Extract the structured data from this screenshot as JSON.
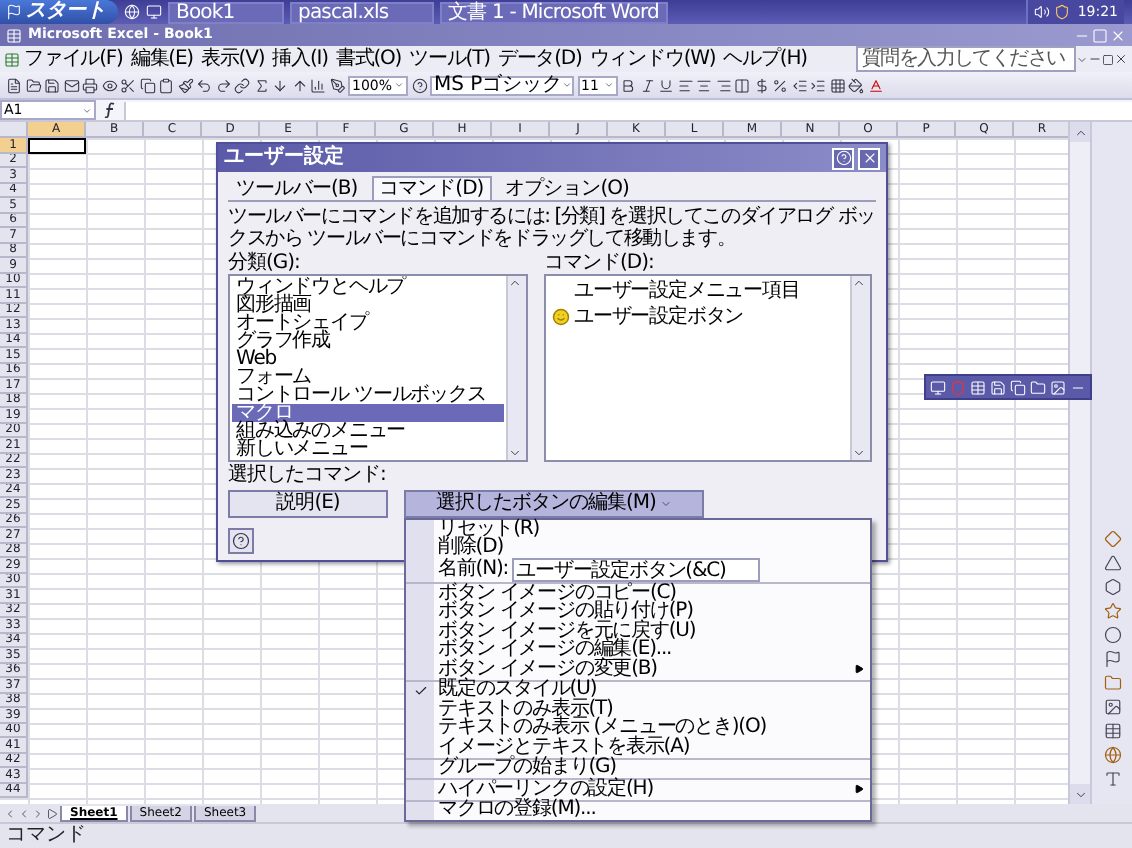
{
  "taskbar": {
    "start": "スタート",
    "tasks": [
      "Book1",
      "pascal.xls",
      "文書 1 - Microsoft Word"
    ],
    "clock": "19:21"
  },
  "window": {
    "title": "Microsoft Excel - Book1"
  },
  "menu_bar": {
    "items": [
      "ファイル(F)",
      "編集(E)",
      "表示(V)",
      "挿入(I)",
      "書式(O)",
      "ツール(T)",
      "データ(D)",
      "ウィンドウ(W)",
      "ヘルプ(H)"
    ],
    "question": {
      "placeholder": "質問を入力してください"
    }
  },
  "toolbar": {
    "zoom": "100%",
    "font": "MS Pゴシック",
    "font_size": "11"
  },
  "formula_bar": {
    "name_box": "A1"
  },
  "sheet": {
    "columns": [
      {
        "label": "A",
        "selected": true
      },
      {
        "label": "B",
        "selected": false
      },
      {
        "label": "C",
        "selected": false
      },
      {
        "label": "D",
        "selected": false
      },
      {
        "label": "E",
        "selected": false
      },
      {
        "label": "F",
        "selected": false
      },
      {
        "label": "G",
        "selected": false
      },
      {
        "label": "H",
        "selected": false
      },
      {
        "label": "I",
        "selected": false
      },
      {
        "label": "J",
        "selected": false
      },
      {
        "label": "K",
        "selected": false
      },
      {
        "label": "L",
        "selected": false
      },
      {
        "label": "M",
        "selected": false
      },
      {
        "label": "N",
        "selected": false
      },
      {
        "label": "O",
        "selected": false
      },
      {
        "label": "P",
        "selected": false
      },
      {
        "label": "Q",
        "selected": false
      },
      {
        "label": "R",
        "selected": false
      }
    ],
    "rows": [
      {
        "label": "1",
        "selected": true
      },
      {
        "label": "2",
        "selected": false
      },
      {
        "label": "3",
        "selected": false
      },
      {
        "label": "4",
        "selected": false
      },
      {
        "label": "5",
        "selected": false
      },
      {
        "label": "6",
        "selected": false
      },
      {
        "label": "7",
        "selected": false
      },
      {
        "label": "8",
        "selected": false
      },
      {
        "label": "9",
        "selected": false
      },
      {
        "label": "10",
        "selected": false
      },
      {
        "label": "11",
        "selected": false
      },
      {
        "label": "12",
        "selected": false
      },
      {
        "label": "13",
        "selected": false
      },
      {
        "label": "14",
        "selected": false
      },
      {
        "label": "15",
        "selected": false
      },
      {
        "label": "16",
        "selected": false
      },
      {
        "label": "17",
        "selected": false
      },
      {
        "label": "18",
        "selected": false
      },
      {
        "label": "19",
        "selected": false
      },
      {
        "label": "20",
        "selected": false
      },
      {
        "label": "21",
        "selected": false
      },
      {
        "label": "22",
        "selected": false
      },
      {
        "label": "23",
        "selected": false
      },
      {
        "label": "24",
        "selected": false
      },
      {
        "label": "25",
        "selected": false
      },
      {
        "label": "26",
        "selected": false
      },
      {
        "label": "27",
        "selected": false
      },
      {
        "label": "28",
        "selected": false
      },
      {
        "label": "29",
        "selected": false
      },
      {
        "label": "30",
        "selected": false
      },
      {
        "label": "31",
        "selected": false
      },
      {
        "label": "32",
        "selected": false
      },
      {
        "label": "33",
        "selected": false
      },
      {
        "label": "34",
        "selected": false
      },
      {
        "label": "35",
        "selected": false
      },
      {
        "label": "36",
        "selected": false
      },
      {
        "label": "37",
        "selected": false
      },
      {
        "label": "38",
        "selected": false
      },
      {
        "label": "39",
        "selected": false
      },
      {
        "label": "40",
        "selected": false
      },
      {
        "label": "41",
        "selected": false
      },
      {
        "label": "42",
        "selected": false
      },
      {
        "label": "43",
        "selected": false
      },
      {
        "label": "44",
        "selected": false
      }
    ]
  },
  "sheet_tabs": [
    {
      "label": "Sheet1",
      "selected": true
    },
    {
      "label": "Sheet2",
      "selected": false
    },
    {
      "label": "Sheet3",
      "selected": false
    }
  ],
  "status_bar": {
    "text": "コマンド"
  },
  "dialog": {
    "title": "ユーザー設定",
    "tabs": [
      {
        "label": "ツールバー(B)",
        "selected": false
      },
      {
        "label": "コマンド(D)",
        "selected": true
      },
      {
        "label": "オプション(O)",
        "selected": false
      }
    ],
    "description": "ツールバーにコマンドを追加するには: [分類] を選択してこのダイアログ ボックスから ツールバーにコマンドをドラッグして移動します。",
    "categories_label": "分類(G):",
    "categories": [
      {
        "label": "ウィンドウとヘルプ",
        "selected": false
      },
      {
        "label": "図形描画",
        "selected": false
      },
      {
        "label": "オートシェイプ",
        "selected": false
      },
      {
        "label": "グラフ作成",
        "selected": false
      },
      {
        "label": "Web",
        "selected": false
      },
      {
        "label": "フォーム",
        "selected": false
      },
      {
        "label": "コントロール ツールボックス",
        "selected": false
      },
      {
        "label": "マクロ",
        "selected": true
      },
      {
        "label": "組み込みのメニュー",
        "selected": false
      },
      {
        "label": "新しいメニュー",
        "selected": false
      }
    ],
    "commands_label": "コマンド(D):",
    "commands": [
      {
        "kind": "menu",
        "label": "ユーザー設定メニュー項目"
      },
      {
        "kind": "button",
        "label": "ユーザー設定ボタン"
      }
    ],
    "selected_command_label": "選択したコマンド:",
    "describe_button": "説明(E)",
    "edit_button": {
      "label": "選択したボタンの編集(M)",
      "expanded": true
    }
  },
  "context_menu": {
    "items": [
      {
        "kind": "item",
        "label": "リセット(R)",
        "checked": false,
        "submenu": false,
        "divider_above": false
      },
      {
        "kind": "item",
        "label": "削除(D)",
        "checked": false,
        "submenu": false,
        "divider_above": false
      },
      {
        "kind": "field",
        "label": "名前(N):",
        "value": "ユーザー設定ボタン(&C)",
        "checked": false,
        "submenu": false,
        "divider_above": false
      },
      {
        "kind": "item",
        "label": "ボタン イメージのコピー(C)",
        "checked": false,
        "submenu": false,
        "divider_above": true
      },
      {
        "kind": "item",
        "label": "ボタン イメージの貼り付け(P)",
        "checked": false,
        "submenu": false,
        "divider_above": false
      },
      {
        "kind": "item",
        "label": "ボタン イメージを元に戻す(U)",
        "checked": false,
        "submenu": false,
        "divider_above": false
      },
      {
        "kind": "item",
        "label": "ボタン イメージの編集(E)...",
        "checked": false,
        "submenu": false,
        "divider_above": false
      },
      {
        "kind": "item",
        "label": "ボタン イメージの変更(B)",
        "checked": false,
        "submenu": true,
        "divider_above": false
      },
      {
        "kind": "item",
        "label": "既定のスタイル(U)",
        "checked": true,
        "submenu": false,
        "divider_above": true
      },
      {
        "kind": "item",
        "label": "テキストのみ表示(T)",
        "checked": false,
        "submenu": false,
        "divider_above": false
      },
      {
        "kind": "item",
        "label": "テキストのみ表示 (メニューのとき)(O)",
        "checked": false,
        "submenu": false,
        "divider_above": false
      },
      {
        "kind": "item",
        "label": "イメージとテキストを表示(A)",
        "checked": false,
        "submenu": false,
        "divider_above": false
      },
      {
        "kind": "item",
        "label": "グループの始まり(G)",
        "checked": false,
        "submenu": false,
        "divider_above": true
      },
      {
        "kind": "item",
        "label": "ハイパーリンクの設定(H)",
        "checked": false,
        "submenu": true,
        "divider_above": true
      },
      {
        "kind": "item",
        "label": "マクロの登録(M)...",
        "checked": false,
        "submenu": false,
        "divider_above": true
      }
    ]
  }
}
